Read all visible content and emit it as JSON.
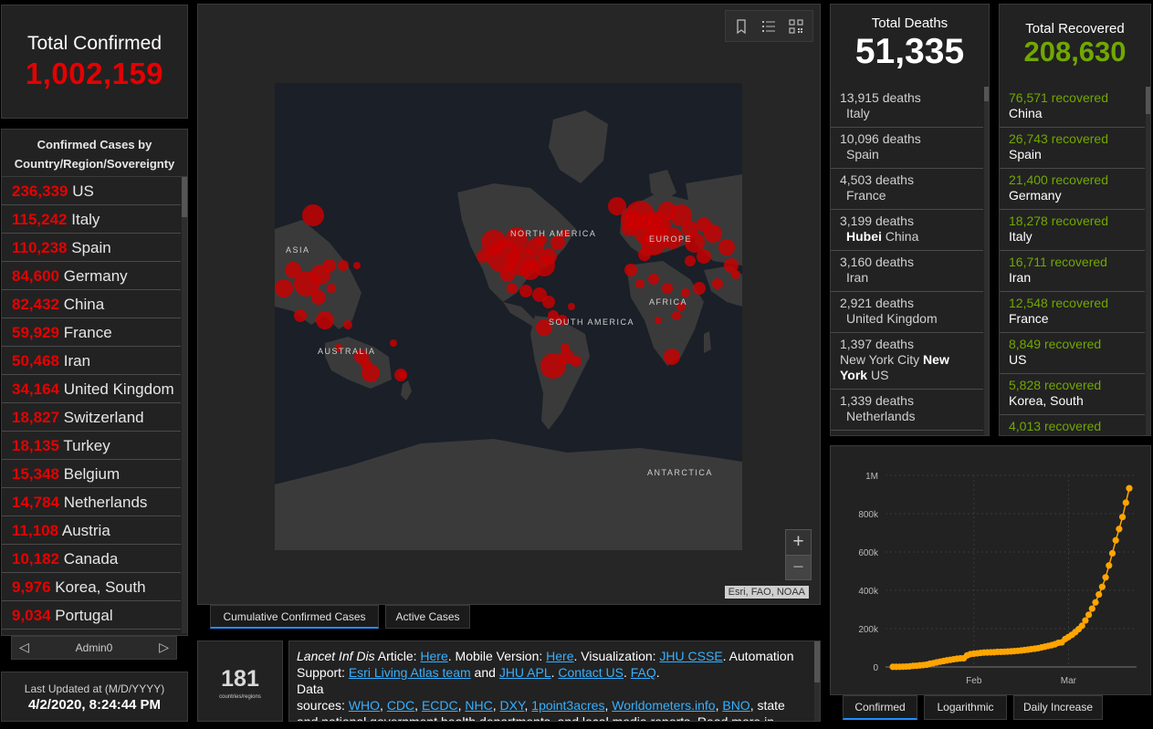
{
  "total_confirmed": {
    "title": "Total Confirmed",
    "value": "1,002,159"
  },
  "confirmed_list": {
    "title": "Confirmed Cases by Country/Region/Sovereignty",
    "rows": [
      {
        "num": "236,339",
        "name": "US"
      },
      {
        "num": "115,242",
        "name": "Italy"
      },
      {
        "num": "110,238",
        "name": "Spain"
      },
      {
        "num": "84,600",
        "name": "Germany"
      },
      {
        "num": "82,432",
        "name": "China"
      },
      {
        "num": "59,929",
        "name": "France"
      },
      {
        "num": "50,468",
        "name": "Iran"
      },
      {
        "num": "34,164",
        "name": "United Kingdom"
      },
      {
        "num": "18,827",
        "name": "Switzerland"
      },
      {
        "num": "18,135",
        "name": "Turkey"
      },
      {
        "num": "15,348",
        "name": "Belgium"
      },
      {
        "num": "14,784",
        "name": "Netherlands"
      },
      {
        "num": "11,108",
        "name": "Austria"
      },
      {
        "num": "10,182",
        "name": "Canada"
      },
      {
        "num": "9,976",
        "name": "Korea, South"
      },
      {
        "num": "9,034",
        "name": "Portugal"
      }
    ]
  },
  "admin_pager": {
    "label": "Admin0",
    "prev": "◁",
    "next": "▷"
  },
  "last_updated": {
    "label": "Last Updated at (M/D/YYYY)",
    "value": "4/2/2020, 8:24:44 PM"
  },
  "map": {
    "labels": {
      "asia": "ASIA",
      "north_america": "NORTH AMERICA",
      "europe": "EUROPE",
      "africa": "AFRICA",
      "south_america": "SOUTH AMERICA",
      "australia": "AUSTRALIA",
      "antarctica": "ANTARCTICA"
    },
    "zoom_in": "+",
    "zoom_out": "−",
    "attribution": "Esri, FAO, NOAA",
    "toolbar": [
      "bookmark-icon",
      "list-icon",
      "qr-grid-icon"
    ],
    "colors": {
      "ocean": "#1a1f28",
      "land": "#3a3a3a",
      "bubble": "#cc0000"
    }
  },
  "map_tabs": {
    "cumulative": "Cumulative Confirmed Cases",
    "active": "Active Cases"
  },
  "countries_count": {
    "value": "181",
    "label": "countries/regions"
  },
  "info": {
    "lancet": "Lancet Inf Dis",
    "article": " Article: ",
    "here1": "Here",
    "mobile": ". Mobile Version: ",
    "here2": "Here",
    "viz": ". Visualization: ",
    "jhu_csse": "JHU CSSE",
    "automation": ". Automation Support: ",
    "esri": "Esri Living Atlas team",
    "and": " and ",
    "jhu_apl": "JHU APL",
    "dot1": ". ",
    "contact": "Contact US",
    "dot2": ". ",
    "faq": "FAQ",
    "dot3": ".",
    "data": "Data",
    "sources": "sources: ",
    "who": "WHO",
    "cdc": "CDC",
    "ecdc": "ECDC",
    "nhc": "NHC",
    "dxy": "DXY",
    "onepoint": "1point3acres",
    "worldometers": "Worldometers.info",
    "bno": "BNO",
    "comma": ", ",
    "rest": ", state and national government health departments, and local media reports. Read more in"
  },
  "deaths": {
    "title": "Total Deaths",
    "value": "51,335",
    "rows": [
      {
        "num": "13,915",
        "unit": "deaths",
        "loc": "Italy"
      },
      {
        "num": "10,096",
        "unit": "deaths",
        "loc": "Spain"
      },
      {
        "num": "4,503",
        "unit": "deaths",
        "loc": "France"
      },
      {
        "num": "3,199",
        "unit": "deaths",
        "bold": "Hubei",
        "loc": " China"
      },
      {
        "num": "3,160",
        "unit": "deaths",
        "loc": "Iran"
      },
      {
        "num": "2,921",
        "unit": "deaths",
        "loc": "United Kingdom"
      },
      {
        "num": "1,397",
        "unit": "deaths",
        "loc_pre": "New York City ",
        "bold": "New York",
        "loc": " US"
      },
      {
        "num": "1,339",
        "unit": "deaths",
        "loc": "Netherlands"
      }
    ]
  },
  "recovered": {
    "title": "Total Recovered",
    "value": "208,630",
    "rows": [
      {
        "num": "76,571",
        "unit": "recovered",
        "loc": "China"
      },
      {
        "num": "26,743",
        "unit": "recovered",
        "loc": "Spain"
      },
      {
        "num": "21,400",
        "unit": "recovered",
        "loc": "Germany"
      },
      {
        "num": "18,278",
        "unit": "recovered",
        "loc": "Italy"
      },
      {
        "num": "16,711",
        "unit": "recovered",
        "loc": "Iran"
      },
      {
        "num": "12,548",
        "unit": "recovered",
        "loc": "France"
      },
      {
        "num": "8,849",
        "unit": "recovered",
        "loc": "US"
      },
      {
        "num": "5,828",
        "unit": "recovered",
        "loc": "Korea, South"
      },
      {
        "num": "4,013",
        "unit": "recovered",
        "loc": ""
      }
    ]
  },
  "chart_data": {
    "type": "line",
    "title": "",
    "xlabel": "",
    "ylabel": "",
    "x_ticks": [
      "Feb",
      "Mar"
    ],
    "y_ticks": [
      "0",
      "200k",
      "400k",
      "600k",
      "800k",
      "1M"
    ],
    "ylim": [
      0,
      1000000
    ],
    "color": "#ffa500",
    "series": [
      {
        "values": [
          555,
          654,
          941,
          1434,
          2118,
          2927,
          5578,
          6166,
          8234,
          9927,
          12038,
          16787,
          19881,
          23892,
          27635,
          30794,
          34391,
          37120,
          40150,
          42762,
          44802,
          45221,
          60368,
          66885,
          69030,
          71224,
          73258,
          75136,
          75639,
          76197,
          76823,
          78579,
          78965,
          79568,
          80413,
          81395,
          82754,
          84120,
          86011,
          88369,
          90306,
          92840,
          95120,
          97886,
          101801,
          105847,
          109821,
          113590,
          118620,
          125875,
          128352,
          145205,
          156101,
          167454,
          181574,
          197102,
          214821,
          242570,
          272208,
          304507,
          336953,
          378235,
          418045,
          467653,
          529591,
          593291,
          660706,
          720117,
          782365,
          857487,
          932605
        ]
      }
    ]
  },
  "chart_tabs": {
    "confirmed": "Confirmed",
    "log": "Logarithmic",
    "daily": "Daily Increase"
  }
}
